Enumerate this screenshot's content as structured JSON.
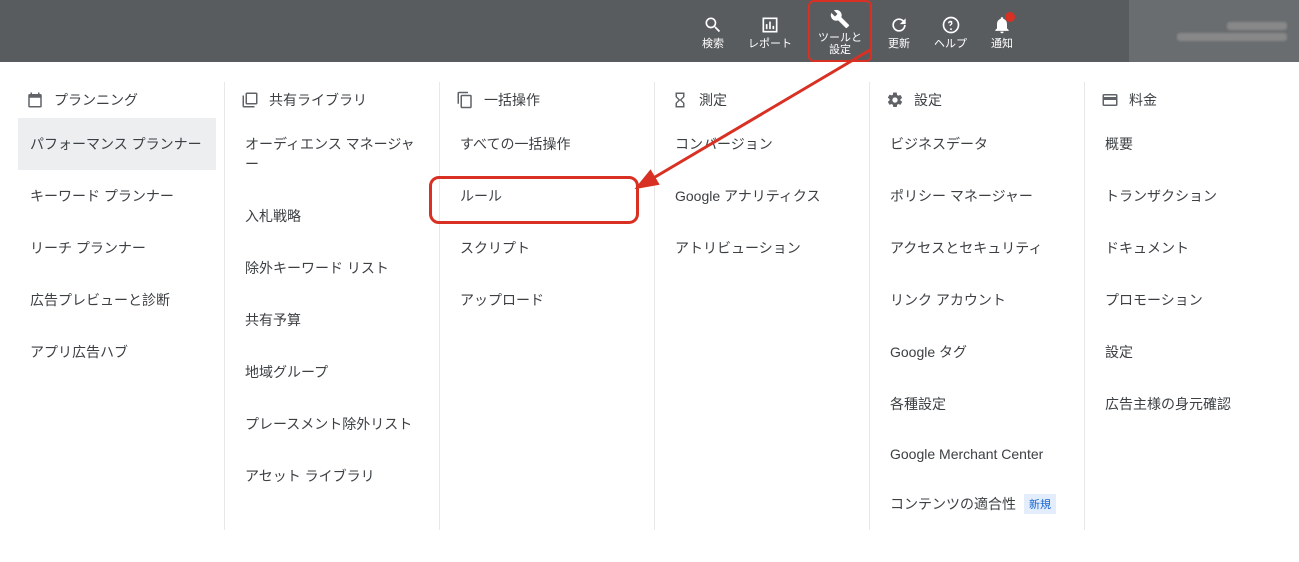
{
  "topbar": {
    "search": "検索",
    "report": "レポート",
    "tools": "ツールと\n設定",
    "refresh": "更新",
    "help": "ヘルプ",
    "notifications": "通知"
  },
  "columns": {
    "planning": {
      "header": "プランニング",
      "items": [
        "パフォーマンス プランナー",
        "キーワード プランナー",
        "リーチ プランナー",
        "広告プレビューと診断",
        "アプリ広告ハブ"
      ]
    },
    "shared": {
      "header": "共有ライブラリ",
      "items": [
        "オーディエンス マネージャー",
        "入札戦略",
        "除外キーワード リスト",
        "共有予算",
        "地域グループ",
        "プレースメント除外リスト",
        "アセット ライブラリ"
      ]
    },
    "bulk": {
      "header": "一括操作",
      "items": [
        "すべての一括操作",
        "ルール",
        "スクリプト",
        "アップロード"
      ]
    },
    "measure": {
      "header": "測定",
      "items": [
        "コンバージョン",
        "Google アナリティクス",
        "アトリビューション"
      ]
    },
    "setup": {
      "header": "設定",
      "items": [
        "ビジネスデータ",
        "ポリシー マネージャー",
        "アクセスとセキュリティ",
        "リンク アカウント",
        "Google タグ",
        "各種設定",
        "Google Merchant Center",
        "コンテンツの適合性"
      ],
      "badge_index": 7,
      "badge_text": "新規"
    },
    "billing": {
      "header": "料金",
      "items": [
        "概要",
        "トランザクション",
        "ドキュメント",
        "プロモーション",
        "設定",
        "広告主様の身元確認"
      ]
    }
  }
}
